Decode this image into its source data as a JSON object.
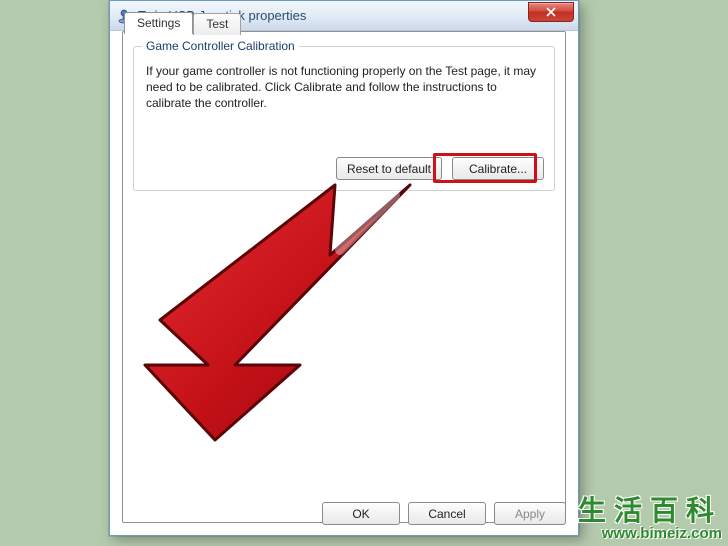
{
  "window": {
    "title": "Twin USB Joystick properties",
    "icon": "joystick-icon"
  },
  "tabs": {
    "items": [
      {
        "label": "Settings",
        "active": true
      },
      {
        "label": "Test",
        "active": false
      }
    ]
  },
  "groupbox": {
    "title": "Game Controller Calibration",
    "body": "If your game controller is not functioning properly on the Test page, it may need to be calibrated.  Click Calibrate and follow the instructions to calibrate the controller.",
    "buttons": {
      "reset": "Reset to default",
      "calibrate": "Calibrate..."
    }
  },
  "dialog_buttons": {
    "ok": "OK",
    "cancel": "Cancel",
    "apply": "Apply"
  },
  "annotation": {
    "arrow_color": "#c31017",
    "highlight_color": "#d01018"
  },
  "watermark": {
    "text_cn": "生活百科",
    "url": "www.bimeiz.com"
  }
}
